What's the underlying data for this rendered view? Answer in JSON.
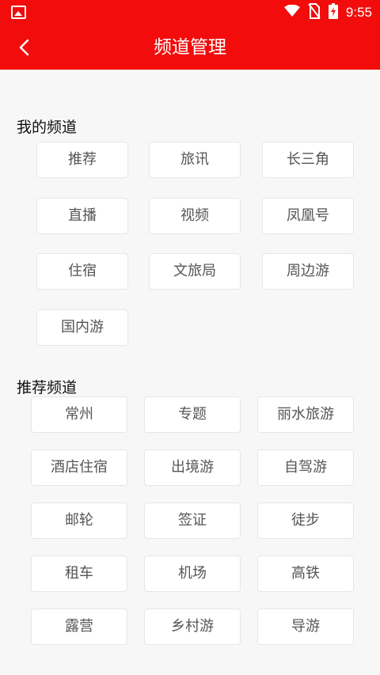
{
  "status_bar": {
    "time": "9:55",
    "icons": [
      "image-icon",
      "wifi-icon",
      "no-sim-icon",
      "battery-charging-icon"
    ]
  },
  "header": {
    "title": "频道管理",
    "back_icon": "chevron-left-icon",
    "background": "#f20c0c"
  },
  "my_channels": {
    "title": "我的频道",
    "items": [
      "推荐",
      "旅讯",
      "长三角",
      "直播",
      "视频",
      "凤凰号",
      "住宿",
      "文旅局",
      "周边游",
      "国内游"
    ]
  },
  "recommended_channels": {
    "title": "推荐频道",
    "items": [
      "常州",
      "专题",
      "丽水旅游",
      "酒店住宿",
      "出境游",
      "自驾游",
      "邮轮",
      "签证",
      "徒步",
      "租车",
      "机场",
      "高铁",
      "露营",
      "乡村游",
      "导游"
    ]
  }
}
